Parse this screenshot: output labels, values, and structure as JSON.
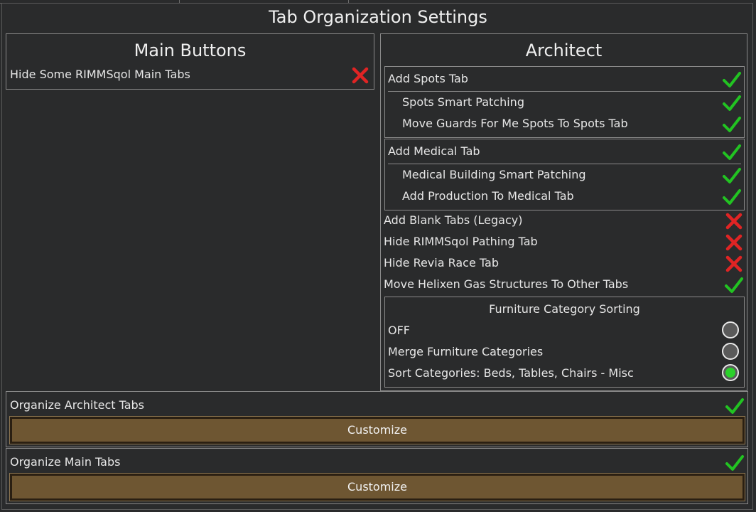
{
  "window": {
    "title": "Tab Organization Settings"
  },
  "main_buttons": {
    "title": "Main Buttons",
    "items": [
      {
        "label": "Hide Some RIMMSqol Main Tabs",
        "state": "off"
      }
    ]
  },
  "architect": {
    "title": "Architect",
    "spots_group": {
      "header": {
        "label": "Add Spots Tab",
        "state": "on"
      },
      "children": [
        {
          "label": "Spots Smart Patching",
          "state": "on"
        },
        {
          "label": "Move Guards For Me Spots To Spots Tab",
          "state": "on"
        }
      ]
    },
    "medical_group": {
      "header": {
        "label": "Add Medical Tab",
        "state": "on"
      },
      "children": [
        {
          "label": "Medical Building Smart Patching",
          "state": "on"
        },
        {
          "label": "Add Production To Medical Tab",
          "state": "on"
        }
      ]
    },
    "toggles": [
      {
        "label": "Add Blank Tabs (Legacy)",
        "state": "off"
      },
      {
        "label": "Hide RIMMSqol Pathing Tab",
        "state": "off"
      },
      {
        "label": "Hide Revia Race Tab",
        "state": "off"
      },
      {
        "label": "Move Helixen Gas Structures To Other Tabs",
        "state": "on"
      }
    ],
    "furniture": {
      "title": "Furniture Category Sorting",
      "options": [
        {
          "label": "OFF",
          "selected": false
        },
        {
          "label": "Merge Furniture Categories",
          "selected": false
        },
        {
          "label": "Sort Categories: Beds, Tables, Chairs - Misc",
          "selected": true
        }
      ]
    }
  },
  "organize_architect": {
    "label": "Organize Architect Tabs",
    "state": "on",
    "button": "Customize"
  },
  "organize_main": {
    "label": "Organize Main Tabs",
    "state": "on",
    "button": "Customize"
  },
  "colors": {
    "check": "#22c322",
    "cross": "#e02424",
    "radio_selected": "#2bd12b",
    "button": "#6e5632"
  },
  "icons": {
    "on": "checkmark-icon",
    "off": "cross-icon"
  }
}
